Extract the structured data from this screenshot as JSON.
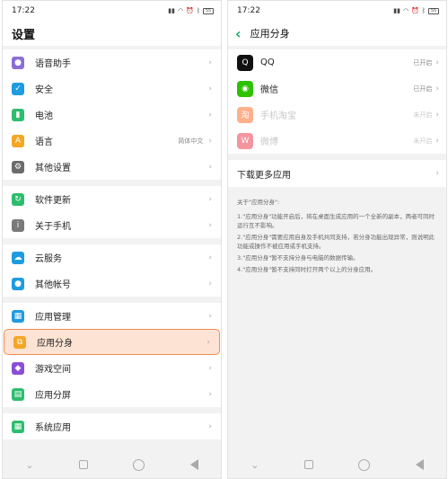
{
  "left": {
    "status": {
      "time": "17:22",
      "icons_text": "HD HD",
      "battery": "55"
    },
    "title": "设置",
    "groups": [
      {
        "items": [
          {
            "label": "语音助手",
            "value": "",
            "icon": "microphone-icon",
            "color": "#8a6fd6"
          },
          {
            "label": "安全",
            "value": "",
            "icon": "shield-icon",
            "color": "#1f9be0"
          },
          {
            "label": "电池",
            "value": "",
            "icon": "battery-icon",
            "color": "#2ebd6e"
          },
          {
            "label": "语言",
            "value": "简体中文",
            "icon": "language-icon",
            "color": "#f5a623"
          },
          {
            "label": "其他设置",
            "value": "",
            "icon": "gear-icon",
            "color": "#6b6b6b"
          }
        ]
      },
      {
        "items": [
          {
            "label": "软件更新",
            "value": "",
            "icon": "update-icon",
            "color": "#2ebd6e"
          },
          {
            "label": "关于手机",
            "value": "",
            "icon": "info-icon",
            "color": "#7a7a7a"
          }
        ]
      },
      {
        "items": [
          {
            "label": "云服务",
            "value": "",
            "icon": "cloud-icon",
            "color": "#1f9be0"
          },
          {
            "label": "其他帐号",
            "value": "",
            "icon": "user-icon",
            "color": "#1f9be0"
          }
        ]
      },
      {
        "items": [
          {
            "label": "应用管理",
            "value": "",
            "icon": "apps-icon",
            "color": "#1f9be0"
          },
          {
            "label": "应用分身",
            "value": "",
            "icon": "clone-icon",
            "color": "#f5a623"
          },
          {
            "label": "游戏空间",
            "value": "",
            "icon": "game-icon",
            "color": "#8a4fd6"
          },
          {
            "label": "应用分屏",
            "value": "",
            "icon": "splitscreen-icon",
            "color": "#2ebd6e"
          }
        ]
      },
      {
        "items": [
          {
            "label": "系统应用",
            "value": "",
            "icon": "system-apps-icon",
            "color": "#2ebd6e"
          }
        ]
      }
    ]
  },
  "right": {
    "status": {
      "time": "17:22",
      "icons_text": "HD HD",
      "battery": "55"
    },
    "title": "应用分身",
    "apps": [
      {
        "label": "QQ",
        "value": "已开启",
        "icon": "qq-icon",
        "color": "#111111",
        "disabled": false
      },
      {
        "label": "微信",
        "value": "已开启",
        "icon": "wechat-icon",
        "color": "#2dc100",
        "disabled": false
      },
      {
        "label": "手机淘宝",
        "value": "未开启",
        "icon": "taobao-icon",
        "color": "#ff5000",
        "disabled": true
      },
      {
        "label": "微博",
        "value": "未开启",
        "icon": "weibo-icon",
        "color": "#e6162d",
        "disabled": true
      }
    ],
    "more": "下载更多应用",
    "notes_title": "关于\"应用分身\":",
    "notes": [
      "1.\"应用分身\"功能开启后，将在桌面生成应用的一个全新的副本，两者可同时运行互不影响。",
      "2.\"应用分身\"需要应用自身及手机共同支持，若分身功能出现异常，则说明此功能或操作不被应用或手机支持。",
      "3.\"应用分身\"暂不支持分身与电脑的数据传输。",
      "4.\"应用分身\"暂不支持同时打开两个以上的分身应用。"
    ]
  }
}
